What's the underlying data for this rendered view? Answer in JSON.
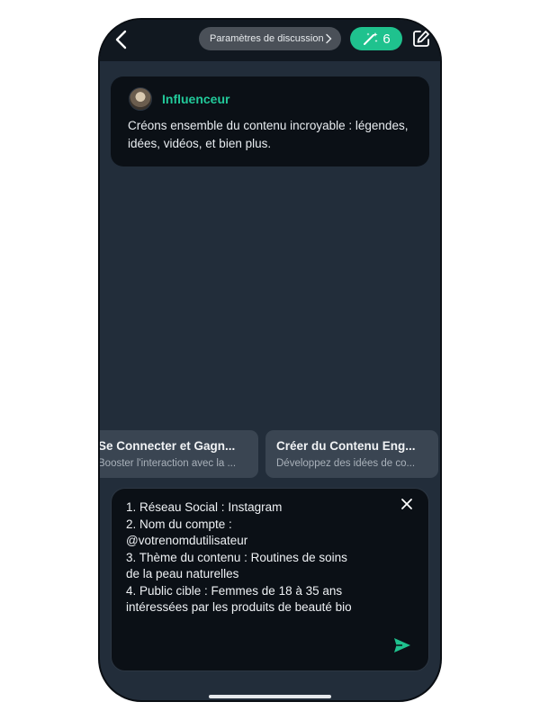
{
  "topbar": {
    "back_icon": "chevron-left-icon",
    "settings_label": "Paramètres de discussion",
    "settings_chevron_icon": "chevron-right-icon",
    "credits_icon": "magic-wand-icon",
    "credits_count": "6",
    "edit_icon": "edit-icon"
  },
  "intro": {
    "agent_name": "Influenceur",
    "message": "Créons ensemble du contenu incroyable : légendes, idées, vidéos, et bien plus."
  },
  "suggestions": [
    {
      "title": "Se Connecter et Gagn...",
      "subtitle": "Booster l'interaction avec la ..."
    },
    {
      "title": "Créer du Contenu Eng...",
      "subtitle": "Développez des idées de co..."
    }
  ],
  "composer": {
    "value": "1. Réseau Social : Instagram\n2. Nom du compte :\n@votrenomdutilisateur\n3. Thème du contenu : Routines de soins\nde la peau naturelles\n4. Public cible : Femmes de 18 à 35 ans\nintéressées par les produits de beauté bio",
    "clear_icon": "close-icon",
    "send_icon": "send-icon"
  },
  "colors": {
    "accent": "#1fc28e",
    "accent_text": "#22c99a",
    "background": "#222d3a",
    "card": "#0b1016"
  }
}
